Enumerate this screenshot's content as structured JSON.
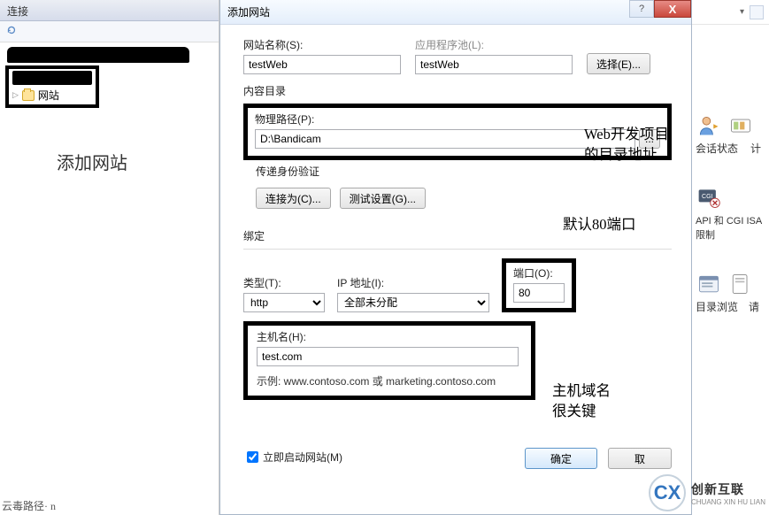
{
  "left": {
    "header": "连接",
    "tree": {
      "site_label": "网站"
    },
    "annotation": "添加网站"
  },
  "dialog": {
    "title": "添加网站",
    "help": "?",
    "close": "X",
    "site_name_label": "网站名称(S):",
    "site_name_value": "testWeb",
    "app_pool_label": "应用程序池(L):",
    "app_pool_value": "testWeb",
    "select_btn": "选择(E)...",
    "content_dir": "内容目录",
    "phys_path_label": "物理路径(P):",
    "phys_path_value": "D:\\Bandicam",
    "browse_btn": "...",
    "pass_auth": "传递身份验证",
    "connect_as_btn": "连接为(C)...",
    "test_settings_btn": "测试设置(G)...",
    "binding": "绑定",
    "type_label": "类型(T):",
    "type_value": "http",
    "ip_label": "IP 地址(I):",
    "ip_value": "全部未分配",
    "port_label": "端口(O):",
    "port_value": "80",
    "host_label": "主机名(H):",
    "host_value": "test.com",
    "example": "示例: www.contoso.com 或 marketing.contoso.com",
    "start_immediately": "立即启动网站(M)",
    "ok_btn": "确定",
    "cancel_btn": "取"
  },
  "annotations": {
    "web_dev_dir": "Web开发项目\n的目录地址",
    "default_port": "默认80端口",
    "host_key": "主机域名\n很关键"
  },
  "right": {
    "item1": "会话状态",
    "item1b": "计",
    "item2": "API 和 CGI ISA\n限制",
    "item3": "目录浏览",
    "item3b": "请"
  },
  "logo": {
    "badge": "CX",
    "cn": "创新互联",
    "en": "CHUANG XIN HU LIAN"
  },
  "bottom_left": "云毒路径· n"
}
